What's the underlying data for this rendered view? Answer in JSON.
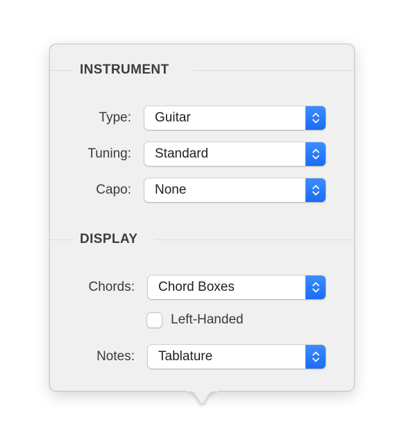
{
  "popover": {
    "sections": [
      {
        "title": "INSTRUMENT",
        "fields": [
          {
            "label": "Type:",
            "value": "Guitar"
          },
          {
            "label": "Tuning:",
            "value": "Standard"
          },
          {
            "label": "Capo:",
            "value": "None"
          }
        ]
      },
      {
        "title": "DISPLAY",
        "fields": [
          {
            "label": "Chords:",
            "value": "Chord Boxes"
          },
          {
            "label": "Notes:",
            "value": "Tablature"
          }
        ],
        "checkbox": {
          "label": "Left-Handed",
          "checked": false
        }
      }
    ]
  },
  "colors": {
    "accent": "#1f73f8",
    "panel_background": "#f0f0f0"
  },
  "icons": {
    "popup_stepper": "chevron-up-down-icon"
  }
}
